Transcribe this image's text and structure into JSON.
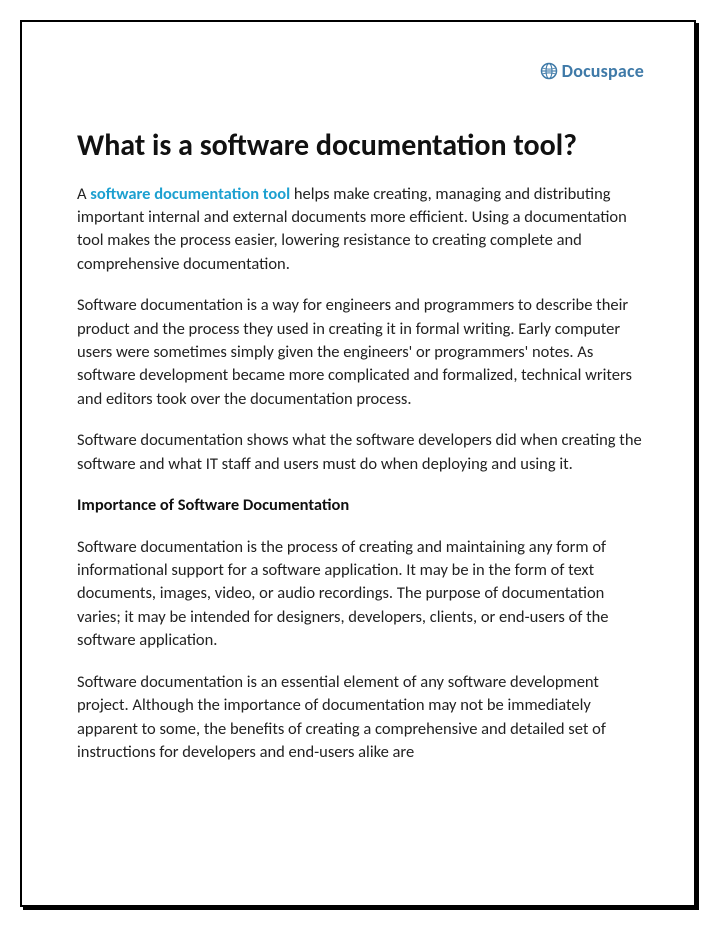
{
  "brand": {
    "name": "Docuspace",
    "icon_name": "globe-icon"
  },
  "title": "What is a software documentation tool?",
  "para1": {
    "prefix": "A ",
    "link_text": "software documentation tool",
    "rest": " helps make creating, managing and distributing important internal and external documents more efficient. Using a documentation tool makes the process easier, lowering resistance to creating complete and comprehensive documentation."
  },
  "para2": "Software documentation is a way for engineers and programmers to describe their product and the process they used in creating it in formal writing. Early computer users were sometimes simply given the engineers' or programmers' notes. As software development became more complicated and formalized, technical writers and editors took over the documentation process.",
  "para3": "Software documentation shows what the software developers did when creating the software and what IT staff and users must do when deploying and using it.",
  "subhead": "Importance of Software Documentation",
  "para4": "Software documentation is the process of creating and maintaining any form of informational support for a software application. It may be in the form of text documents, images, video, or audio recordings. The purpose of documentation varies; it may be intended for designers, developers, clients, or end-users of the software application.",
  "para5": "Software documentation is an essential element of any software development project. Although the importance of documentation may not be immediately apparent to some, the benefits of creating a comprehensive and detailed set of instructions for developers and end-users alike are"
}
